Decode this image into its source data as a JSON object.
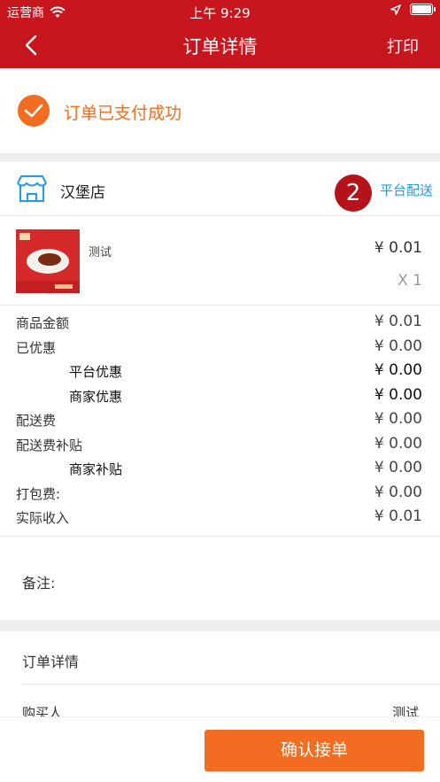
{
  "status_bar": {
    "carrier": "运营商",
    "time": "上午 9:29"
  },
  "nav": {
    "title": "订单详情",
    "print_label": "打印"
  },
  "paid": {
    "text": "订单已支付成功"
  },
  "store": {
    "name": "汉堡店",
    "badge": "2",
    "delivery": "平台配送"
  },
  "product": {
    "name": "测试",
    "price": "¥ 0.01",
    "qty": "X 1"
  },
  "amounts": [
    {
      "label": "商品金额",
      "value": "¥ 0.01"
    },
    {
      "label": "已优惠",
      "value": "¥ 0.00"
    },
    {
      "label": "平台优惠",
      "value": "¥ 0.00"
    },
    {
      "label": "商家优惠",
      "value": "¥ 0.00"
    },
    {
      "label": "配送费",
      "value": "¥ 0.00"
    },
    {
      "label": "配送费补贴",
      "value": "¥ 0.00"
    },
    {
      "label": "商家补贴",
      "value": "¥ 0.00"
    },
    {
      "label": "打包费:",
      "value": "¥ 0.00"
    },
    {
      "label": "实际收入",
      "value": "¥ 0.01"
    }
  ],
  "remark": {
    "label": "备注:"
  },
  "order_detail": {
    "title": "订单详情",
    "buyer_label": "购买人",
    "buyer_value": "测试"
  },
  "footer": {
    "confirm_label": "确认接单"
  },
  "colors": {
    "header": "#c8161e",
    "accent": "#f26d21",
    "link": "#1e9be9",
    "badge": "#b5121b"
  },
  "icons": [
    "wifi-icon",
    "location-arrow-icon",
    "battery-icon",
    "back-icon",
    "check-icon",
    "shop-icon"
  ]
}
